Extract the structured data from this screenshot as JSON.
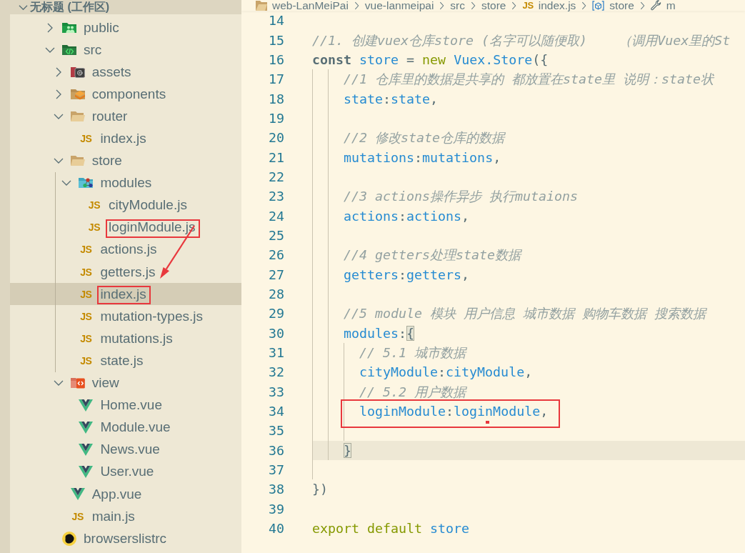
{
  "sidebar": {
    "workspace": {
      "title": "无标题 (工作区)",
      "expanded": true
    },
    "tree": [
      {
        "name": "public",
        "kind": "folder_public",
        "expanded": false,
        "selected": false,
        "annotated": false
      },
      {
        "name": "src",
        "kind": "folder_src",
        "expanded": true,
        "selected": false,
        "annotated": false,
        "children": [
          {
            "name": "assets",
            "kind": "folder_assets",
            "expanded": false,
            "selected": false,
            "annotated": false
          },
          {
            "name": "components",
            "kind": "folder_components",
            "expanded": false,
            "selected": false,
            "annotated": false
          },
          {
            "name": "router",
            "kind": "folder",
            "expanded": true,
            "selected": false,
            "annotated": false,
            "children": [
              {
                "name": "index.js",
                "kind": "js",
                "badge": "JS",
                "selected": false,
                "annotated": false
              }
            ]
          },
          {
            "name": "store",
            "kind": "folder",
            "expanded": true,
            "selected": false,
            "annotated": false,
            "children": [
              {
                "name": "modules",
                "kind": "folder_modules",
                "expanded": true,
                "selected": false,
                "annotated": false,
                "children": [
                  {
                    "name": "cityModule.js",
                    "kind": "js",
                    "badge": "JS",
                    "selected": false,
                    "annotated": false
                  },
                  {
                    "name": "loginModule.js",
                    "kind": "js",
                    "badge": "JS",
                    "selected": false,
                    "annotated": true
                  }
                ]
              },
              {
                "name": "actions.js",
                "kind": "js",
                "badge": "JS",
                "selected": false,
                "annotated": false
              },
              {
                "name": "getters.js",
                "kind": "js",
                "badge": "JS",
                "selected": false,
                "annotated": false
              },
              {
                "name": "index.js",
                "kind": "js",
                "badge": "JS",
                "selected": true,
                "annotated": true
              },
              {
                "name": "mutation-types.js",
                "kind": "js",
                "badge": "JS",
                "selected": false,
                "annotated": false
              },
              {
                "name": "mutations.js",
                "kind": "js",
                "badge": "JS",
                "selected": false,
                "annotated": false
              },
              {
                "name": "state.js",
                "kind": "js",
                "badge": "JS",
                "selected": false,
                "annotated": false
              }
            ]
          },
          {
            "name": "view",
            "kind": "folder_view",
            "expanded": true,
            "selected": false,
            "annotated": false,
            "children": [
              {
                "name": "Home.vue",
                "kind": "vue",
                "selected": false,
                "annotated": false
              },
              {
                "name": "Module.vue",
                "kind": "vue",
                "selected": false,
                "annotated": false
              },
              {
                "name": "News.vue",
                "kind": "vue",
                "selected": false,
                "annotated": false
              },
              {
                "name": "User.vue",
                "kind": "vue",
                "selected": false,
                "annotated": false
              }
            ]
          },
          {
            "name": "App.vue",
            "kind": "vue",
            "selected": false,
            "annotated": false
          },
          {
            "name": "main.js",
            "kind": "js",
            "badge": "JS",
            "selected": false,
            "annotated": false
          }
        ]
      },
      {
        "name": "browserslistrc",
        "kind": "browserslist",
        "selected": false,
        "annotated": false
      }
    ]
  },
  "editor": {
    "breadcrumb": [
      {
        "text": "web-LanMeiPai",
        "kind": "root"
      },
      {
        "text": "vue-lanmeipai",
        "kind": "folder"
      },
      {
        "text": "src",
        "kind": "folder"
      },
      {
        "text": "store",
        "kind": "folder"
      },
      {
        "text": "index.js",
        "kind": "js",
        "badge": "JS"
      },
      {
        "text": "store",
        "kind": "variable"
      },
      {
        "text": "m",
        "kind": "property"
      }
    ],
    "lines": [
      {
        "number": "14",
        "current": false,
        "annotated": false
      },
      {
        "number": "15",
        "current": false,
        "annotated": false,
        "tokens": [
          {
            "kind": "comment",
            "text": "//1. 创建vuex仓库store (名字可以随便取)    （调用Vuex里的St"
          }
        ]
      },
      {
        "number": "16",
        "current": false,
        "annotated": false,
        "tokens": [
          {
            "kind": "storage",
            "text": "const"
          },
          {
            "kind": "identifier",
            "text": " store"
          },
          {
            "kind": "plain",
            "text": " = "
          },
          {
            "kind": "keyword",
            "text": "new"
          },
          {
            "kind": "identifier",
            "text": " Vuex.Store"
          },
          {
            "kind": "plain",
            "text": "({"
          }
        ]
      },
      {
        "number": "17",
        "current": false,
        "annotated": false,
        "tokens": [
          {
            "kind": "comment",
            "text": "    //1 仓库里的数据是共享的 都放置在state里 说明：state状"
          }
        ]
      },
      {
        "number": "18",
        "current": false,
        "annotated": false,
        "tokens": [
          {
            "kind": "identifier",
            "text": "    state"
          },
          {
            "kind": "plain",
            "text": ":"
          },
          {
            "kind": "identifier",
            "text": "state"
          },
          {
            "kind": "plain",
            "text": ","
          }
        ]
      },
      {
        "number": "19",
        "current": false,
        "annotated": false
      },
      {
        "number": "20",
        "current": false,
        "annotated": false,
        "tokens": [
          {
            "kind": "comment",
            "text": "    //2 修改state仓库的数据"
          }
        ]
      },
      {
        "number": "21",
        "current": false,
        "annotated": false,
        "tokens": [
          {
            "kind": "identifier",
            "text": "    mutations"
          },
          {
            "kind": "plain",
            "text": ":"
          },
          {
            "kind": "identifier",
            "text": "mutations"
          },
          {
            "kind": "plain",
            "text": ","
          }
        ]
      },
      {
        "number": "22",
        "current": false,
        "annotated": false
      },
      {
        "number": "23",
        "current": false,
        "annotated": false,
        "tokens": [
          {
            "kind": "comment",
            "text": "    //3 actions操作异步 执行mutaions"
          }
        ]
      },
      {
        "number": "24",
        "current": false,
        "annotated": false,
        "tokens": [
          {
            "kind": "identifier",
            "text": "    actions"
          },
          {
            "kind": "plain",
            "text": ":"
          },
          {
            "kind": "identifier",
            "text": "actions"
          },
          {
            "kind": "plain",
            "text": ","
          }
        ]
      },
      {
        "number": "25",
        "current": false,
        "annotated": false
      },
      {
        "number": "26",
        "current": false,
        "annotated": false,
        "tokens": [
          {
            "kind": "comment",
            "text": "    //4 getters处理state数据"
          }
        ]
      },
      {
        "number": "27",
        "current": false,
        "annotated": false,
        "tokens": [
          {
            "kind": "identifier",
            "text": "    getters"
          },
          {
            "kind": "plain",
            "text": ":"
          },
          {
            "kind": "identifier",
            "text": "getters"
          },
          {
            "kind": "plain",
            "text": ","
          }
        ]
      },
      {
        "number": "28",
        "current": false,
        "annotated": false
      },
      {
        "number": "29",
        "current": false,
        "annotated": false,
        "tokens": [
          {
            "kind": "comment",
            "text": "    //5 module 模块 用户信息 城市数据 购物车数据 搜索数据"
          }
        ]
      },
      {
        "number": "30",
        "current": false,
        "annotated": false,
        "tokens": [
          {
            "kind": "identifier",
            "text": "    modules"
          },
          {
            "kind": "plain",
            "text": ":"
          },
          {
            "kind": "bracket_match",
            "text": "{"
          }
        ]
      },
      {
        "number": "31",
        "current": false,
        "annotated": false,
        "tokens": [
          {
            "kind": "comment",
            "text": "      // 5.1 城市数据"
          }
        ]
      },
      {
        "number": "32",
        "current": false,
        "annotated": false,
        "tokens": [
          {
            "kind": "identifier",
            "text": "      cityModule"
          },
          {
            "kind": "plain",
            "text": ":"
          },
          {
            "kind": "identifier",
            "text": "cityModule"
          },
          {
            "kind": "plain",
            "text": ","
          }
        ]
      },
      {
        "number": "33",
        "current": false,
        "annotated": false,
        "tokens": [
          {
            "kind": "comment",
            "text": "      // 5.2 用户数据"
          }
        ]
      },
      {
        "number": "34",
        "current": false,
        "annotated": true,
        "tokens": [
          {
            "kind": "identifier",
            "text": "      loginModule"
          },
          {
            "kind": "plain",
            "text": ":"
          },
          {
            "kind": "identifier",
            "text": "loginModule"
          },
          {
            "kind": "plain",
            "text": ","
          }
        ]
      },
      {
        "number": "35",
        "current": false,
        "annotated": false
      },
      {
        "number": "36",
        "current": true,
        "annotated": false,
        "tokens": [
          {
            "kind": "bracket_match",
            "text": "    }"
          }
        ]
      },
      {
        "number": "37",
        "current": false,
        "annotated": false
      },
      {
        "number": "38",
        "current": false,
        "annotated": false,
        "tokens": [
          {
            "kind": "plain",
            "text": "})"
          }
        ]
      },
      {
        "number": "39",
        "current": false,
        "annotated": false
      },
      {
        "number": "40",
        "current": false,
        "annotated": false,
        "tokens": [
          {
            "kind": "keyword",
            "text": "export default"
          },
          {
            "kind": "identifier",
            "text": " store"
          }
        ]
      }
    ]
  }
}
